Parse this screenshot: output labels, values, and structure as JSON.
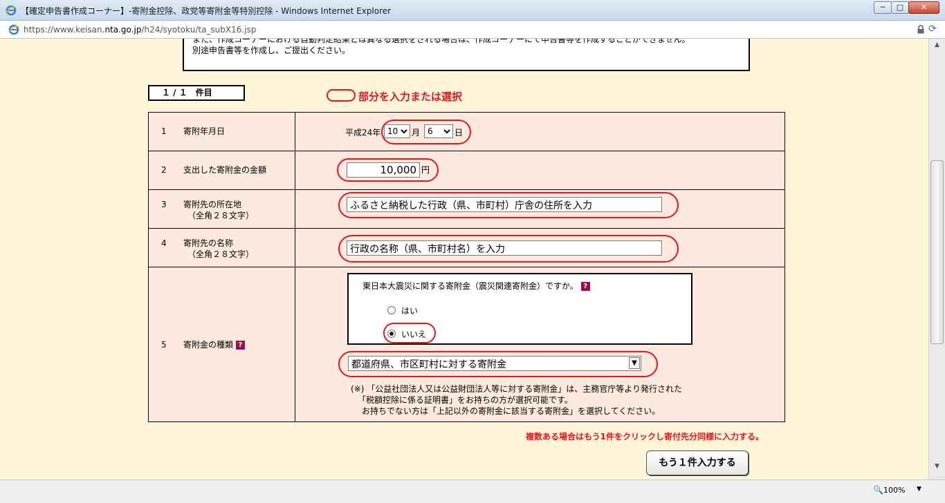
{
  "window": {
    "title": "【確定申告書作成コーナー】-寄附金控除、政党等寄附金等特別控除 - Windows Internet Explorer",
    "minimize_label": "─",
    "maximize_label": "□",
    "close_label": "✕"
  },
  "address": {
    "prefix": "https://www.keisan.",
    "domain": "nta.go.jp",
    "path": "/h24/syotoku/ta_subX16.jsp"
  },
  "notice": {
    "line1": "また、作成コーナーにおける自動判定結果とは異なる選択をされる場合は、作成コーナーにて申告書等を作成することができません。",
    "line2": "別途申告書等を作成し、ご提出ください。"
  },
  "counter": "１ / １　件目",
  "legend_text": "部分を入力または選択",
  "rows": [
    {
      "num": "1",
      "label": "寄附年月日"
    },
    {
      "num": "2",
      "label": "支出した寄附金の金額"
    },
    {
      "num": "3",
      "label": "寄附先の所在地",
      "sub": "（全角２８文字）"
    },
    {
      "num": "4",
      "label": "寄附先の名称",
      "sub": "（全角２８文字）"
    },
    {
      "num": "5",
      "label": "寄附金の種類"
    }
  ],
  "date": {
    "era_prefix": "平成24年",
    "month": "10",
    "month_unit": "月",
    "day": "6",
    "day_unit": "日"
  },
  "amount": {
    "value": "10,000",
    "unit": "円"
  },
  "address_field": {
    "value": "ふるさと納税した行政（県、市町村）庁舎の住所を入力"
  },
  "name_field": {
    "value": "行政の名称（県、市町村名）を入力"
  },
  "quake": {
    "question": "東日本大震災に関する寄附金（震災関連寄附金）ですか。",
    "yes": "はい",
    "no": "いいえ",
    "selected": "いいえ"
  },
  "donation_type": {
    "selected": "都道府県、市区町村に対する寄附金"
  },
  "notes": [
    "(※) 「公益社団法人又は公益財団法人等に対する寄附金」は、主務官庁等より発行された",
    "「税額控除に係る証明書」をお持ちの方が選択可能です。",
    "お持ちでない方は「上記以外の寄附金に該当する寄附金」を選択してください。"
  ],
  "help_icon": "?",
  "warning": "複数ある場合はもう1件をクリックし寄付先分同様に入力する。",
  "add_button": "もう１件入力する",
  "status": {
    "zoom": "100%"
  },
  "colors": {
    "accent_red": "#e8141e",
    "page_bg": "#fff6d9",
    "row_bg": "#fde9dd"
  }
}
